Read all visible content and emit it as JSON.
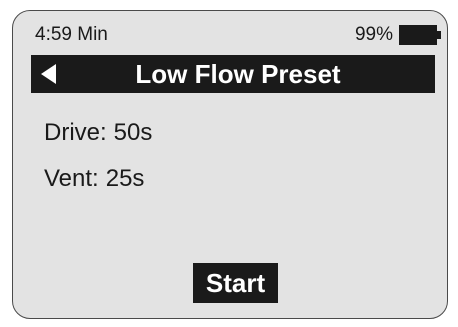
{
  "status": {
    "time": "4:59 Min",
    "battery_percent": "99%",
    "battery_icon": "battery-full-icon"
  },
  "header": {
    "back_icon": "back-arrow-icon",
    "title": "Low Flow Preset"
  },
  "params": [
    {
      "label": "Drive:",
      "value": "50s"
    },
    {
      "label": "Vent:",
      "value": "25s"
    }
  ],
  "actions": {
    "start_label": "Start"
  },
  "colors": {
    "screen_background": "#e3e3e3",
    "foreground": "#1a1a1a",
    "inverse_text": "#ffffff"
  }
}
